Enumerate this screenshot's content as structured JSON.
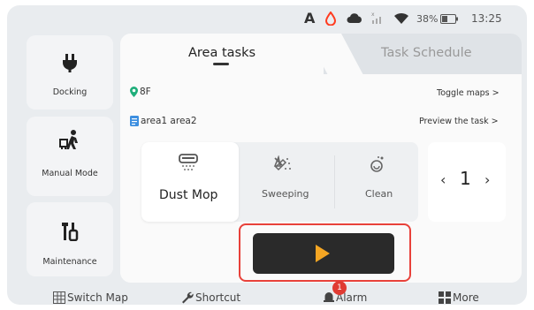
{
  "status_bar": {
    "letter": "A",
    "battery_percent": "38%",
    "time": "13:25",
    "colors": {
      "drop": "#ff3b1f"
    }
  },
  "sidebar": {
    "items": [
      {
        "label": "Docking",
        "icon": "plug-icon"
      },
      {
        "label": "Manual Mode",
        "icon": "person-pushing-icon"
      },
      {
        "label": "Maintenance",
        "icon": "tools-icon"
      }
    ]
  },
  "tabs": [
    {
      "label": "Area tasks",
      "active": true
    },
    {
      "label": "Task Schedule",
      "active": false
    }
  ],
  "task": {
    "floor": "8F",
    "areas": "area1 area2",
    "toggle_maps": "Toggle maps >",
    "preview_task": "Preview the task >"
  },
  "modes": [
    {
      "label": "Dust Mop",
      "icon": "dust-mop-icon",
      "selected": true
    },
    {
      "label": "Sweeping",
      "icon": "sweeping-icon",
      "selected": false
    },
    {
      "label": "Clean",
      "icon": "clean-icon",
      "selected": false
    }
  ],
  "count": {
    "value": "1",
    "dec": "‹",
    "inc": "›"
  },
  "play_button": {
    "icon": "play-icon",
    "color": "#f5a623"
  },
  "bottom_bar": {
    "items": [
      {
        "label": "Switch Map",
        "icon": "map-grid-icon"
      },
      {
        "label": "Shortcut",
        "icon": "wrench-icon"
      },
      {
        "label": "Alarm",
        "icon": "alarm-icon",
        "badge": "1"
      },
      {
        "label": "More",
        "icon": "more-grid-icon"
      }
    ]
  }
}
